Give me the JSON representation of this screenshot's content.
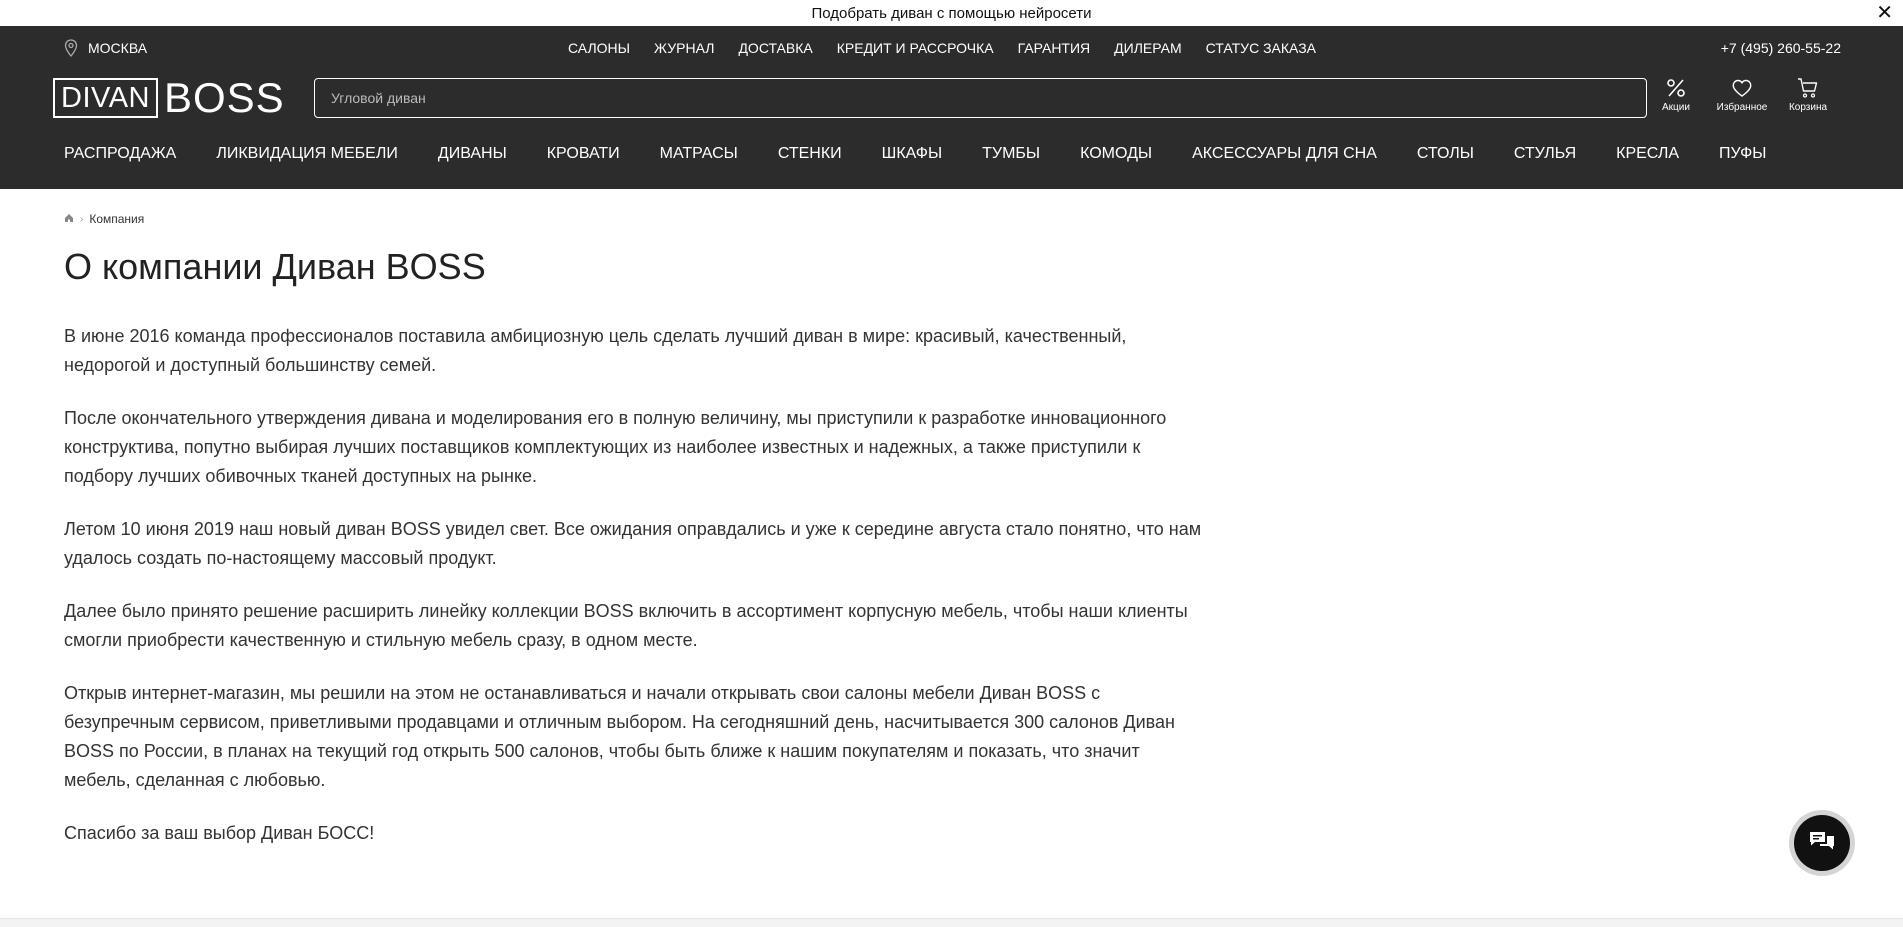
{
  "promo": {
    "text": "Подобрать диван с помощью нейросети",
    "close": "✕"
  },
  "header": {
    "city": "МОСКВА",
    "top_nav": [
      "САЛОНЫ",
      "ЖУРНАЛ",
      "ДОСТАВКА",
      "КРЕДИТ И РАССРОЧКА",
      "ГАРАНТИЯ",
      "ДИЛЕРАМ",
      "СТАТУС ЗАКАЗА"
    ],
    "phone": "+7 (495) 260-55-22",
    "logo": {
      "box_text": "DIVAN",
      "text": "BOSS"
    },
    "search": {
      "placeholder": "Угловой диван",
      "value": ""
    },
    "icons": {
      "sales": "Акции",
      "favorites": "Избранное",
      "cart": "Корзина"
    },
    "categories": [
      "РАСПРОДАЖА",
      "ЛИКВИДАЦИЯ МЕБЕЛИ",
      "ДИВАНЫ",
      "КРОВАТИ",
      "МАТРАСЫ",
      "СТЕНКИ",
      "ШКАФЫ",
      "ТУМБЫ",
      "КОМОДЫ",
      "АКСЕССУАРЫ ДЛЯ СНА",
      "СТОЛЫ",
      "СТУЛЬЯ",
      "КРЕСЛА",
      "ПУФЫ"
    ]
  },
  "breadcrumb": {
    "current": "Компания"
  },
  "page": {
    "title": "О компании Диван BOSS",
    "paragraphs": [
      "В июне 2016 команда профессионалов поставила амбициозную цель сделать лучший диван в мире: красивый, качественный, недорогой и доступный большинству семей.",
      "После окончательного утверждения дивана и моделирования его в полную величину, мы приступили к разработке инновационного конструктива, попутно выбирая лучших поставщиков комплектующих из наиболее известных и надежных, а также приступили к подбору лучших обивочных тканей доступных на рынке.",
      "Летом 10 июня 2019 наш новый диван BOSS увидел свет. Все ожидания оправдались и уже к середине августа стало понятно, что нам удалось создать по-настоящему массовый продукт.",
      "Далее было принято решение расширить линейку коллекции BOSS включить в ассортимент корпусную мебель, чтобы наши клиенты смогли приобрести качественную и стильную мебель сразу, в одном месте.",
      "Открыв интернет-магазин, мы решили на этом не останавливаться и начали открывать свои салоны мебели Диван BOSS с безупречным сервисом, приветливыми продавцами и отличным выбором. На сегодняшний день, насчитывается 300 салонов Диван BOSS по России, в планах на текущий год открыть 500 салонов, чтобы быть ближе к нашим покупателям и показать, что значит мебель, сделанная с любовью.",
      "Спасибо за ваш выбор Диван БОСС!"
    ]
  },
  "colors": {
    "header_bg": "#2c2c2c",
    "text": "#222222"
  }
}
